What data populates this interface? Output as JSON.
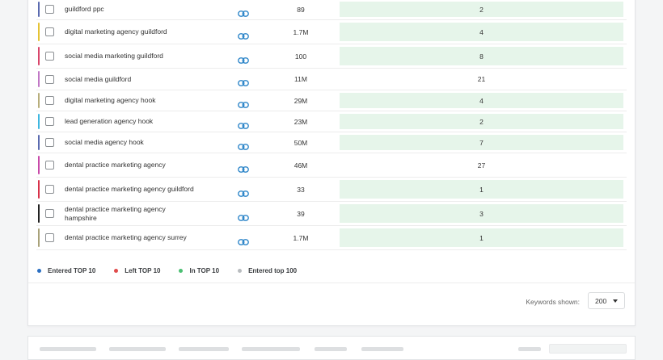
{
  "rows": [
    {
      "keyword": "guildford ppc",
      "volume": "89",
      "position": "2",
      "bar_color": "#5b6bb0",
      "highlight": true
    },
    {
      "keyword": "digital marketing agency guildford",
      "volume": "1.7M",
      "position": "4",
      "bar_color": "#e5c335",
      "highlight": true
    },
    {
      "keyword": "social media marketing guildford",
      "volume": "100",
      "position": "8",
      "bar_color": "#d9466b",
      "highlight": true
    },
    {
      "keyword": "social media guildford",
      "volume": "11M",
      "position": "21",
      "bar_color": "#c178c6",
      "highlight": false
    },
    {
      "keyword": "digital marketing agency hook",
      "volume": "29M",
      "position": "4",
      "bar_color": "#b8ae7c",
      "highlight": true
    },
    {
      "keyword": "lead generation agency hook",
      "volume": "23M",
      "position": "2",
      "bar_color": "#3fb7e0",
      "highlight": true
    },
    {
      "keyword": "social media agency hook",
      "volume": "50M",
      "position": "7",
      "bar_color": "#5b6bb0",
      "highlight": true
    },
    {
      "keyword": "dental practice marketing agency",
      "volume": "46M",
      "position": "27",
      "bar_color": "#c84aa9",
      "highlight": false
    },
    {
      "keyword": "dental practice marketing agency guildford",
      "volume": "33",
      "position": "1",
      "bar_color": "#d8324a",
      "highlight": true
    },
    {
      "keyword": "dental practice marketing agency hampshire",
      "volume": "39",
      "position": "3",
      "bar_color": "#222222",
      "highlight": true
    },
    {
      "keyword": "dental practice marketing agency surrey",
      "volume": "1.7M",
      "position": "1",
      "bar_color": "#a9a27a",
      "highlight": true
    }
  ],
  "legend": [
    {
      "label": "Entered TOP 10",
      "color": "#2b6fc2"
    },
    {
      "label": "Left TOP 10",
      "color": "#e04b4b"
    },
    {
      "label": "In TOP 10",
      "color": "#4cbf73"
    },
    {
      "label": "Entered top 100",
      "color": "#b8bcbf"
    }
  ],
  "footer": {
    "keywords_shown_label": "Keywords shown:",
    "keywords_shown_value": "200"
  },
  "colors": {
    "link": "#2e86c9",
    "highlight": "#e6f5ea"
  }
}
